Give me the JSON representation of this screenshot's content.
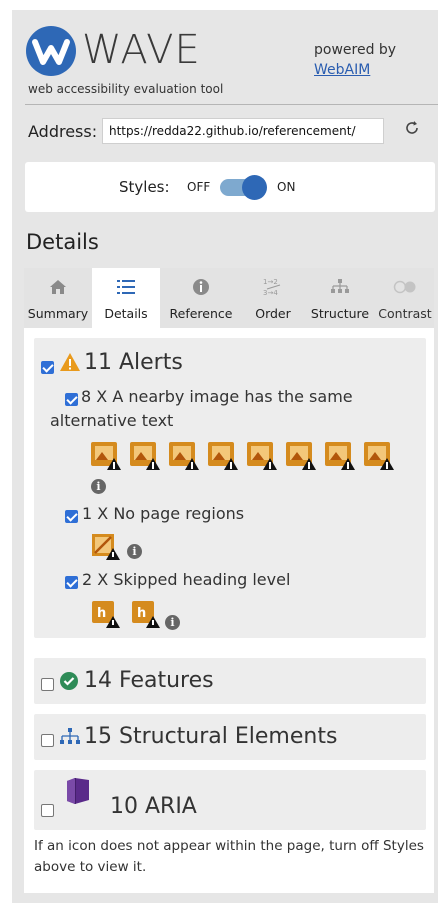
{
  "header": {
    "logo_text": "WAVE",
    "tagline": "web accessibility evaluation tool",
    "powered_by": "powered by",
    "webaim_link": "WebAIM"
  },
  "address": {
    "label": "Address:",
    "value": "https://redda22.github.io/referencement/"
  },
  "styles": {
    "label": "Styles:",
    "off": "OFF",
    "on": "ON"
  },
  "heading": "Details",
  "tabs": [
    {
      "label": "Summary",
      "icon": "home-icon"
    },
    {
      "label": "Details",
      "icon": "list-icon",
      "active": true
    },
    {
      "label": "Reference",
      "icon": "info-icon"
    },
    {
      "label": "Order",
      "icon": "order-icon"
    },
    {
      "label": "Structure",
      "icon": "structure-icon"
    },
    {
      "label": "Contrast",
      "icon": "contrast-icon"
    }
  ],
  "alerts": {
    "title": "11 Alerts",
    "items": [
      {
        "text": "8 X A nearby image has the same alternative text",
        "count": 8
      },
      {
        "text": "1 X No page regions",
        "count": 1
      },
      {
        "text": "2 X Skipped heading level",
        "count": 2
      }
    ]
  },
  "features": {
    "title": "14 Features"
  },
  "structural": {
    "title": "15 Structural Elements"
  },
  "aria": {
    "title": "10 ARIA"
  },
  "footer_note": "If an icon does not appear within the page, turn off Styles above to view it.",
  "colors": {
    "brand_blue": "#2e68b6",
    "alert_orange": "#d58b1e",
    "feature_green": "#2e8b57",
    "aria_purple": "#5a2a8a"
  }
}
